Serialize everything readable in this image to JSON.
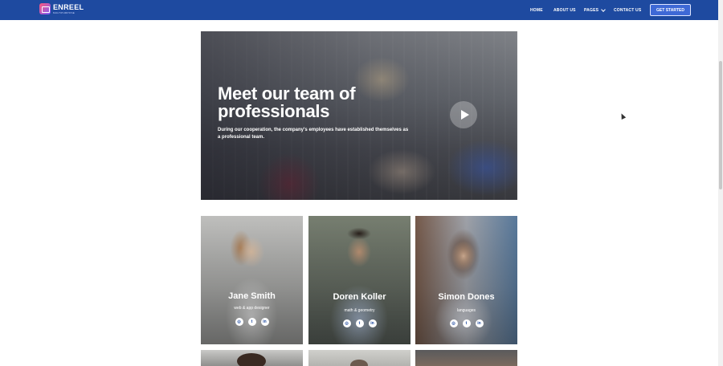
{
  "header": {
    "logo_name": "ENREEL",
    "logo_tagline": "MULTIPURPOSE",
    "background": "#1e4aa0",
    "nav": [
      {
        "label": "HOME"
      },
      {
        "label": "ABOUT US"
      },
      {
        "label": "PAGES"
      },
      {
        "label": "CONTACT US"
      }
    ],
    "cta_label": "GET STARTED"
  },
  "hero": {
    "title": "Meet our team of professionals",
    "subtitle": "During our cooperation, the company's employees have established themselves as a professional team.",
    "play_icon": "play-icon"
  },
  "team": [
    {
      "name": "Jane Smith",
      "role": "web & app designer",
      "socials": [
        "instagram-icon",
        "twitter-icon",
        "linkedin-icon"
      ]
    },
    {
      "name": "Doren Koller",
      "role": "math & geometry",
      "socials": [
        "instagram-icon",
        "twitter-icon",
        "linkedin-icon"
      ]
    },
    {
      "name": "Simon Dones",
      "role": "languages",
      "socials": [
        "instagram-icon",
        "twitter-icon",
        "linkedin-icon"
      ]
    }
  ]
}
